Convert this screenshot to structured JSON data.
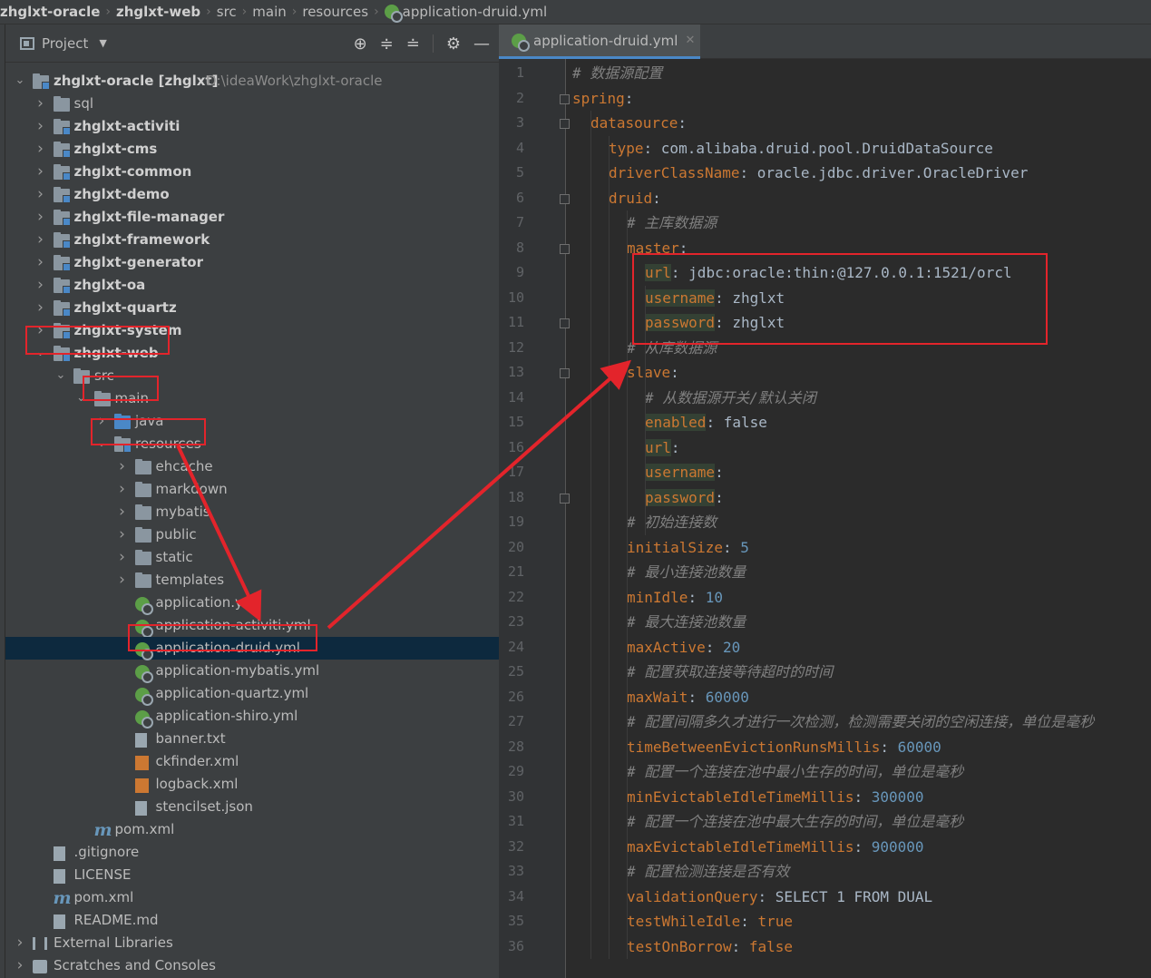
{
  "breadcrumb": [
    "zhglxt-oracle",
    "zhglxt-web",
    "src",
    "main",
    "resources",
    "application-druid.yml"
  ],
  "project_panel": {
    "title": "Project",
    "tools": [
      "locate-icon",
      "expand-all-icon",
      "collapse-all-icon",
      "gear-icon",
      "hide-icon"
    ]
  },
  "tree": [
    {
      "label": "zhglxt-oracle [zhglxt]",
      "hint": "D:\\ideaWork\\zhglxt-oracle",
      "icon": "module-folder-icon",
      "bold": true,
      "expanded": true
    },
    {
      "label": "sql",
      "icon": "folder-icon"
    },
    {
      "label": "zhglxt-activiti",
      "icon": "module-folder-icon",
      "bold": true
    },
    {
      "label": "zhglxt-cms",
      "icon": "module-folder-icon",
      "bold": true
    },
    {
      "label": "zhglxt-common",
      "icon": "module-folder-icon",
      "bold": true
    },
    {
      "label": "zhglxt-demo",
      "icon": "module-folder-icon",
      "bold": true
    },
    {
      "label": "zhglxt-file-manager",
      "icon": "module-folder-icon",
      "bold": true
    },
    {
      "label": "zhglxt-framework",
      "icon": "module-folder-icon",
      "bold": true
    },
    {
      "label": "zhglxt-generator",
      "icon": "module-folder-icon",
      "bold": true
    },
    {
      "label": "zhglxt-oa",
      "icon": "module-folder-icon",
      "bold": true
    },
    {
      "label": "zhglxt-quartz",
      "icon": "module-folder-icon",
      "bold": true
    },
    {
      "label": "zhglxt-system",
      "icon": "module-folder-icon",
      "bold": true
    },
    {
      "label": "zhglxt-web",
      "icon": "module-folder-icon",
      "bold": true,
      "expanded": true
    },
    {
      "label": "src",
      "icon": "folder-icon",
      "expanded": true
    },
    {
      "label": "main",
      "icon": "folder-icon",
      "expanded": true
    },
    {
      "label": "java",
      "icon": "source-folder-icon"
    },
    {
      "label": "resources",
      "icon": "resources-folder-icon",
      "expanded": true
    },
    {
      "label": "ehcache",
      "icon": "folder-icon"
    },
    {
      "label": "markdown",
      "icon": "folder-icon"
    },
    {
      "label": "mybatis",
      "icon": "folder-icon"
    },
    {
      "label": "public",
      "icon": "folder-icon"
    },
    {
      "label": "static",
      "icon": "folder-icon"
    },
    {
      "label": "templates",
      "icon": "folder-icon"
    },
    {
      "label": "application.yml",
      "icon": "spring-yml-icon"
    },
    {
      "label": "application-activiti.yml",
      "icon": "spring-yml-icon"
    },
    {
      "label": "application-druid.yml",
      "icon": "spring-yml-icon",
      "selected": true
    },
    {
      "label": "application-mybatis.yml",
      "icon": "spring-yml-icon"
    },
    {
      "label": "application-quartz.yml",
      "icon": "spring-yml-icon"
    },
    {
      "label": "application-shiro.yml",
      "icon": "spring-yml-icon"
    },
    {
      "label": "banner.txt",
      "icon": "text-file-icon"
    },
    {
      "label": "ckfinder.xml",
      "icon": "xml-file-icon"
    },
    {
      "label": "logback.xml",
      "icon": "xml-file-icon"
    },
    {
      "label": "stencilset.json",
      "icon": "json-file-icon"
    },
    {
      "label": "pom.xml",
      "icon": "maven-icon"
    },
    {
      "label": ".gitignore",
      "icon": "text-file-icon"
    },
    {
      "label": "LICENSE",
      "icon": "text-file-icon"
    },
    {
      "label": "pom.xml",
      "icon": "maven-icon"
    },
    {
      "label": "README.md",
      "icon": "markdown-file-icon"
    },
    {
      "label": "External Libraries",
      "icon": "libraries-icon"
    },
    {
      "label": "Scratches and Consoles",
      "icon": "scratches-icon"
    }
  ],
  "editor": {
    "tab_label": "application-druid.yml",
    "lines": [
      {
        "no": "1",
        "ind": 0,
        "parts": [
          [
            "c",
            "# 数据源配置"
          ]
        ]
      },
      {
        "no": "2",
        "ind": 0,
        "parts": [
          [
            "k",
            "spring"
          ],
          [
            "p",
            ":"
          ]
        ]
      },
      {
        "no": "3",
        "ind": 1,
        "parts": [
          [
            "k",
            "datasource"
          ],
          [
            "p",
            ":"
          ]
        ]
      },
      {
        "no": "4",
        "ind": 2,
        "parts": [
          [
            "k",
            "type"
          ],
          [
            "p",
            ": com.alibaba.druid.pool.DruidDataSource"
          ]
        ]
      },
      {
        "no": "5",
        "ind": 2,
        "parts": [
          [
            "k",
            "driverClassName"
          ],
          [
            "p",
            ": oracle.jdbc.driver.OracleDriver"
          ]
        ]
      },
      {
        "no": "6",
        "ind": 2,
        "parts": [
          [
            "k",
            "druid"
          ],
          [
            "p",
            ":"
          ]
        ]
      },
      {
        "no": "7",
        "ind": 3,
        "parts": [
          [
            "c",
            "# 主库数据源"
          ]
        ]
      },
      {
        "no": "8",
        "ind": 3,
        "parts": [
          [
            "k",
            "master"
          ],
          [
            "p",
            ":"
          ]
        ]
      },
      {
        "no": "9",
        "ind": 4,
        "parts": [
          [
            "kh",
            "url"
          ],
          [
            "p",
            ": jdbc:oracle:thin:@127.0.0.1:1521/orcl"
          ]
        ]
      },
      {
        "no": "10",
        "ind": 4,
        "parts": [
          [
            "kh",
            "username"
          ],
          [
            "p",
            ": zhglxt"
          ]
        ]
      },
      {
        "no": "11",
        "ind": 4,
        "parts": [
          [
            "kh",
            "password"
          ],
          [
            "p",
            ": zhglxt"
          ]
        ]
      },
      {
        "no": "12",
        "ind": 3,
        "parts": [
          [
            "c",
            "# 从库数据源"
          ]
        ]
      },
      {
        "no": "13",
        "ind": 3,
        "parts": [
          [
            "k",
            "slave"
          ],
          [
            "p",
            ":"
          ]
        ]
      },
      {
        "no": "14",
        "ind": 4,
        "parts": [
          [
            "c",
            "# 从数据源开关/默认关闭"
          ]
        ]
      },
      {
        "no": "15",
        "ind": 4,
        "parts": [
          [
            "kh",
            "enabled"
          ],
          [
            "p",
            ": false"
          ]
        ]
      },
      {
        "no": "16",
        "ind": 4,
        "parts": [
          [
            "kh",
            "url"
          ],
          [
            "p",
            ":"
          ]
        ]
      },
      {
        "no": "17",
        "ind": 4,
        "parts": [
          [
            "kh",
            "username"
          ],
          [
            "p",
            ":"
          ]
        ]
      },
      {
        "no": "18",
        "ind": 4,
        "parts": [
          [
            "kh",
            "password"
          ],
          [
            "p",
            ":"
          ]
        ]
      },
      {
        "no": "19",
        "ind": 3,
        "parts": [
          [
            "c",
            "# 初始连接数"
          ]
        ]
      },
      {
        "no": "20",
        "ind": 3,
        "parts": [
          [
            "k",
            "initialSize"
          ],
          [
            "p",
            ": "
          ],
          [
            "n",
            "5"
          ]
        ]
      },
      {
        "no": "21",
        "ind": 3,
        "parts": [
          [
            "c",
            "# 最小连接池数量"
          ]
        ]
      },
      {
        "no": "22",
        "ind": 3,
        "parts": [
          [
            "k",
            "minIdle"
          ],
          [
            "p",
            ": "
          ],
          [
            "n",
            "10"
          ]
        ]
      },
      {
        "no": "23",
        "ind": 3,
        "parts": [
          [
            "c",
            "# 最大连接池数量"
          ]
        ]
      },
      {
        "no": "24",
        "ind": 3,
        "parts": [
          [
            "k",
            "maxActive"
          ],
          [
            "p",
            ": "
          ],
          [
            "n",
            "20"
          ]
        ]
      },
      {
        "no": "25",
        "ind": 3,
        "parts": [
          [
            "c",
            "# 配置获取连接等待超时的时间"
          ]
        ]
      },
      {
        "no": "26",
        "ind": 3,
        "parts": [
          [
            "k",
            "maxWait"
          ],
          [
            "p",
            ": "
          ],
          [
            "n",
            "60000"
          ]
        ]
      },
      {
        "no": "27",
        "ind": 3,
        "parts": [
          [
            "c",
            "# 配置间隔多久才进行一次检测，检测需要关闭的空闲连接，单位是毫秒"
          ]
        ]
      },
      {
        "no": "28",
        "ind": 3,
        "parts": [
          [
            "k",
            "timeBetweenEvictionRunsMillis"
          ],
          [
            "p",
            ": "
          ],
          [
            "n",
            "60000"
          ]
        ]
      },
      {
        "no": "29",
        "ind": 3,
        "parts": [
          [
            "c",
            "# 配置一个连接在池中最小生存的时间，单位是毫秒"
          ]
        ]
      },
      {
        "no": "30",
        "ind": 3,
        "parts": [
          [
            "k",
            "minEvictableIdleTimeMillis"
          ],
          [
            "p",
            ": "
          ],
          [
            "n",
            "300000"
          ]
        ]
      },
      {
        "no": "31",
        "ind": 3,
        "parts": [
          [
            "c",
            "# 配置一个连接在池中最大生存的时间，单位是毫秒"
          ]
        ]
      },
      {
        "no": "32",
        "ind": 3,
        "parts": [
          [
            "k",
            "maxEvictableIdleTimeMillis"
          ],
          [
            "p",
            ": "
          ],
          [
            "n",
            "900000"
          ]
        ]
      },
      {
        "no": "33",
        "ind": 3,
        "parts": [
          [
            "c",
            "# 配置检测连接是否有效"
          ]
        ]
      },
      {
        "no": "34",
        "ind": 3,
        "parts": [
          [
            "k",
            "validationQuery"
          ],
          [
            "p",
            ": SELECT 1 FROM DUAL"
          ]
        ]
      },
      {
        "no": "35",
        "ind": 3,
        "parts": [
          [
            "k",
            "testWhileIdle"
          ],
          [
            "p",
            ": "
          ],
          [
            "k",
            "true"
          ]
        ]
      },
      {
        "no": "36",
        "ind": 3,
        "parts": [
          [
            "k",
            "testOnBorrow"
          ],
          [
            "p",
            ": "
          ],
          [
            "k",
            "false"
          ]
        ]
      }
    ]
  },
  "colors": {
    "annotation_red": "#e3242b",
    "selection": "#0d293e",
    "keyword": "#cc7832",
    "comment": "#808080",
    "number": "#6897bb"
  }
}
